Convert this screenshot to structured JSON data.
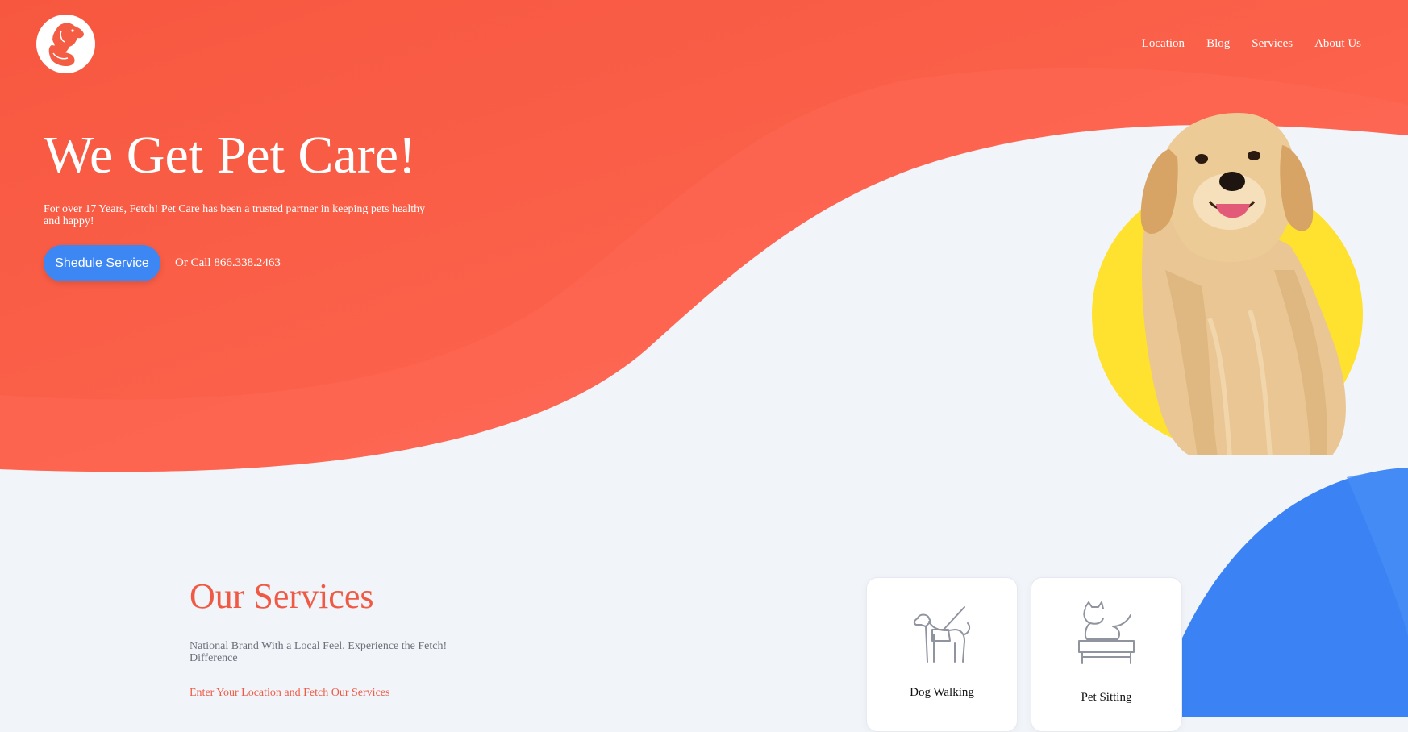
{
  "brand": {
    "logo_icon": "dog-cat-logo-icon",
    "primary_color": "#f45d44",
    "accent_blue": "#3d87f5",
    "accent_yellow": "#ffe12f"
  },
  "nav": {
    "items": [
      {
        "label": "Location"
      },
      {
        "label": "Blog"
      },
      {
        "label": "Services"
      },
      {
        "label": "About Us"
      }
    ]
  },
  "hero": {
    "title": "We Get Pet Care!",
    "subtitle": "For over 17 Years, Fetch! Pet Care has been a trusted partner in keeping pets healthy and happy!",
    "cta_label": "Shedule Service",
    "call_text": "Or Call 866.338.2463",
    "image": "golden-retriever-photo"
  },
  "services": {
    "title": "Our Services",
    "subtitle": "National Brand With a Local Feel. Experience the Fetch! Difference",
    "link_text": "Enter Your Location and Fetch Our Services",
    "cards": [
      {
        "label": "Dog Walking",
        "icon": "dog-walking-icon"
      },
      {
        "label": "Pet Sitting",
        "icon": "pet-sitting-icon"
      }
    ]
  }
}
